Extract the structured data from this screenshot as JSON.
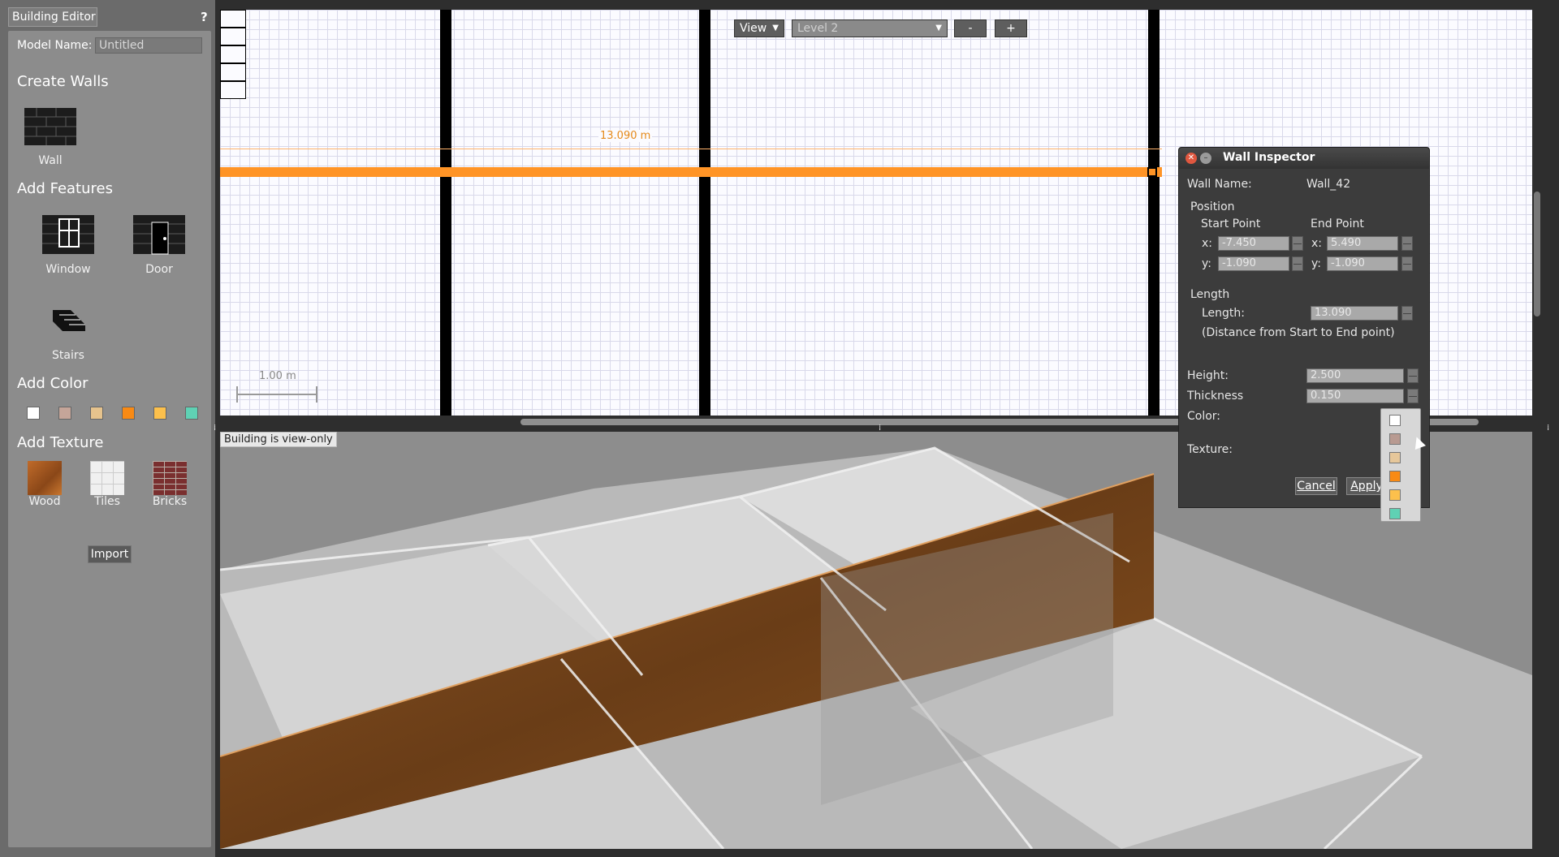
{
  "palette": {
    "tab_label": "Building Editor",
    "help_label": "?",
    "model_name_label": "Model Name:",
    "model_name_value": "Untitled",
    "create_walls_title": "Create Walls",
    "wall_label": "Wall",
    "add_features_title": "Add Features",
    "window_label": "Window",
    "door_label": "Door",
    "stairs_label": "Stairs",
    "add_color_title": "Add Color",
    "colors": [
      "#ffffff",
      "#c5a599",
      "#e6c38d",
      "#f98a14",
      "#fcc04c",
      "#5fd1b4"
    ],
    "add_texture_title": "Add Texture",
    "wood_label": "Wood",
    "tiles_label": "Tiles",
    "bricks_label": "Bricks",
    "import_label": "Import"
  },
  "plan": {
    "view_label": "View",
    "level_label": "Level 2",
    "zoom_out_label": "-",
    "zoom_in_label": "+",
    "measure_label": "13.090 m",
    "scale_label": "1.00 m"
  },
  "view3d": {
    "status_text": "Building is view-only"
  },
  "dialog": {
    "title": "Wall Inspector",
    "wall_name_label": "Wall Name:",
    "wall_name_value": "Wall_42",
    "position_label": "Position",
    "start_point_label": "Start Point",
    "end_point_label": "End Point",
    "x_label": "x:",
    "y_label": "y:",
    "start_x": "-7.450",
    "start_y": "-1.090",
    "end_x": "5.490",
    "end_y": "-1.090",
    "length_section": "Length",
    "length_label": "Length:",
    "length_value": "13.090",
    "length_note": "(Distance from Start to End point)",
    "height_label": "Height:",
    "height_value": "2.500",
    "thickness_label": "Thickness",
    "thickness_value": "0.150",
    "color_label": "Color:",
    "texture_label": "Texture:",
    "cancel_label": "Cancel",
    "apply_label": "Apply",
    "color_options": [
      "#ffffff",
      "#b89a91",
      "#e6c79a",
      "#f98a14",
      "#fcc04c",
      "#5fd1b4"
    ]
  }
}
